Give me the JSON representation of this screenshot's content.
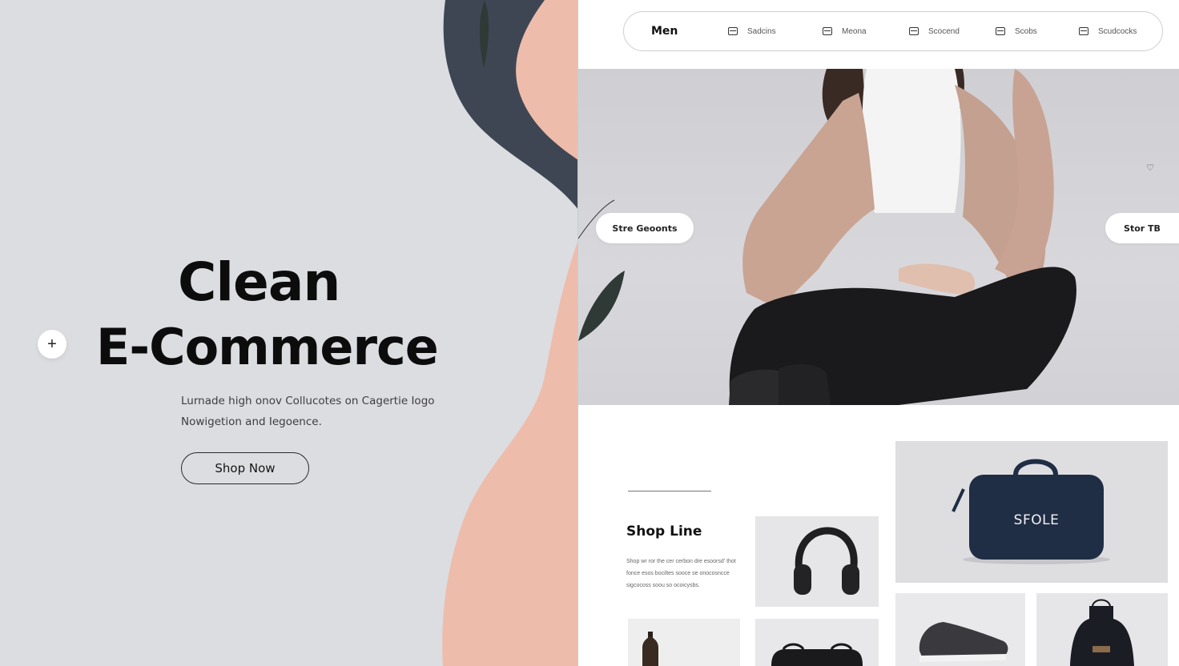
{
  "hero": {
    "title_line1": "Clean",
    "title_line2": "E-Commerce",
    "subtitle_line1": "Lurnade high onov Collucotes on Cagertie Iogo",
    "subtitle_line2": "Nowigetion and Iegoence.",
    "cta_label": "Shop Now",
    "plus_symbol": "+"
  },
  "nav": {
    "brand": "Men",
    "items": [
      {
        "label": "Sadcins",
        "icon": "card-icon"
      },
      {
        "label": "Meona",
        "icon": "card-icon"
      },
      {
        "label": "Scocend",
        "icon": "card-icon"
      },
      {
        "label": "Scobs",
        "icon": "card-icon"
      },
      {
        "label": "Scudcocks",
        "icon": "card-icon"
      }
    ]
  },
  "photo": {
    "left_pill": "Stre Geoonts",
    "right_pill": "Stor TB",
    "heart_symbol": "♡"
  },
  "products": {
    "section_title": "Shop Line",
    "description": "Shop wr ror the cer cerbon dre esoorsd' thot fonce esos bociltes sooce se onocosncce sigcocoss soou so ocoicysbs.",
    "bag_label": "SFOLE"
  },
  "colors": {
    "left_bg": "#dcdde1",
    "navy_blob": "#3f4653",
    "peach_blob": "#eebcab",
    "leaf": "#2f3a36",
    "bag_navy": "#1f2d45"
  }
}
